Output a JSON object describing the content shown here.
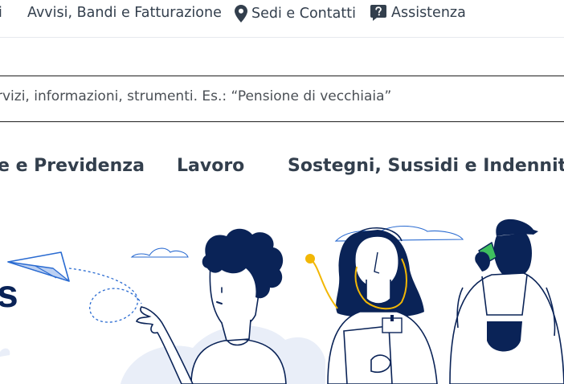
{
  "top_nav": {
    "items": [
      {
        "label": "i"
      },
      {
        "label": "Avvisi, Bandi e Fatturazione"
      },
      {
        "label": "Sedi e Contatti",
        "icon": "map-pin-icon"
      },
      {
        "label": "Assistenza",
        "icon": "help-icon"
      }
    ]
  },
  "search": {
    "placeholder": "rvizi, informazioni, strumenti. Es.: “Pensione di vecchiaia”"
  },
  "main_nav": {
    "items": [
      {
        "label": "e e Previdenza"
      },
      {
        "label": "Lavoro"
      },
      {
        "label": "Sostegni, Sussidi e Indennità"
      }
    ]
  },
  "hero": {
    "partial_title": "s"
  },
  "colors": {
    "text": "#333f4d",
    "navy": "#0a2357",
    "accent_yellow": "#f2b705",
    "accent_green": "#3fbf5f",
    "light_blue": "#e9eef8"
  }
}
